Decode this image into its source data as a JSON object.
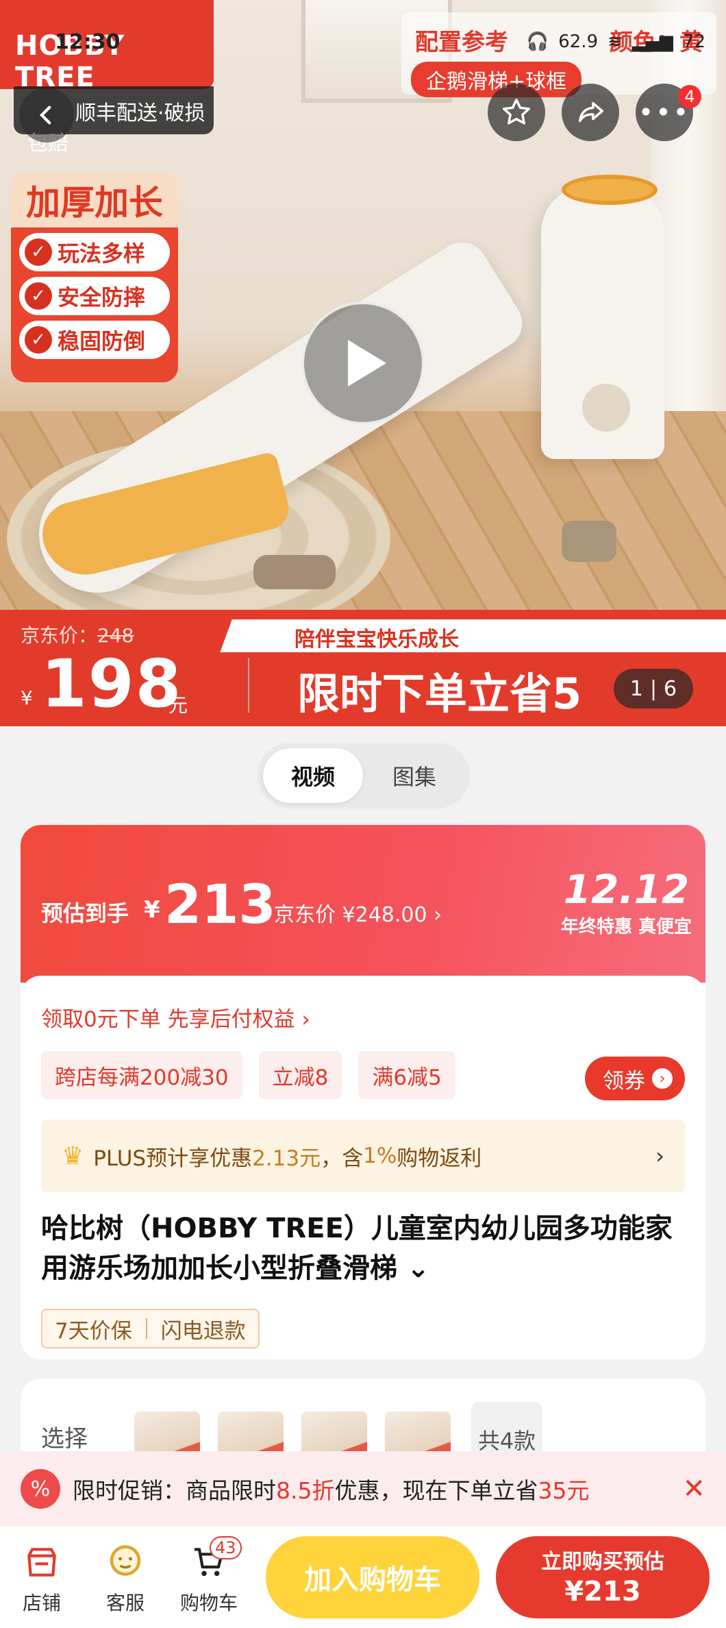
{
  "status_bar": {
    "time": "12:30",
    "network_speed": "62.9",
    "battery": "72"
  },
  "hero": {
    "brand_logo": "HOBBY TREE",
    "shipping_tag": "顺丰配送·破损包赔",
    "promo_top_left": "配置参考",
    "promo_top_right": "颜色：黄",
    "promo_top_tag": "企鹅滑梯+球框",
    "feature_title": "加厚加长",
    "features": [
      "玩法多样",
      "安全防摔",
      "稳固防倒"
    ],
    "more_badge": "4",
    "price_strip": {
      "jd_label": "京东价：",
      "jd_price": "248",
      "yen": "¥",
      "price": "198",
      "yuan": "元",
      "slogan": "陪伴宝宝快乐成长",
      "limited": "限时下单立省5"
    },
    "image_counter": {
      "current": "1",
      "total": "6"
    }
  },
  "media_tabs": {
    "video": "视频",
    "gallery": "图集"
  },
  "price_banner": {
    "estimated_label": "预估到手",
    "estimated_yen": "¥",
    "estimated_price": "213",
    "jd_price_text": "京东价 ¥248.00 ›",
    "event_date": "12.12",
    "event_slogan": "年终特惠 真便宜"
  },
  "coupons": {
    "first_pay": "领取0元下单 先享后付权益 ›",
    "chips": [
      "跨店每满200减30",
      "立减8",
      "满6减5"
    ],
    "get_coupon": "领券",
    "plus_prefix": "PLUS预计享优惠",
    "plus_amount": "2.13元",
    "plus_suffix": "，含",
    "plus_rebate": "1%",
    "plus_tail": "购物返利"
  },
  "product": {
    "title": "哈比树（HOBBY TREE）儿童室内幼儿园多功能家用游乐场加加长小型折叠滑梯 ⌄",
    "guarantee_1": "7天价保",
    "guarantee_2": "闪电退款"
  },
  "options": {
    "label": "选择",
    "count": "共4款"
  },
  "notice": {
    "icon": "%",
    "prefix": "限时促销：商品限时",
    "discount": "8.5折",
    "middle": "优惠，现在下单立省",
    "saving": "35元"
  },
  "bottom_bar": {
    "store": "店铺",
    "service": "客服",
    "cart": "购物车",
    "cart_count": "43",
    "add_to_cart": "加入购物车",
    "buy_now_line1": "立即购买预估",
    "buy_now_line2": "¥213"
  },
  "colors": {
    "brand_red": "#e33a2e",
    "accent_yellow": "#ffd43b",
    "coupon_red": "#e9392c",
    "plus_bg": "#fdf3e2"
  }
}
